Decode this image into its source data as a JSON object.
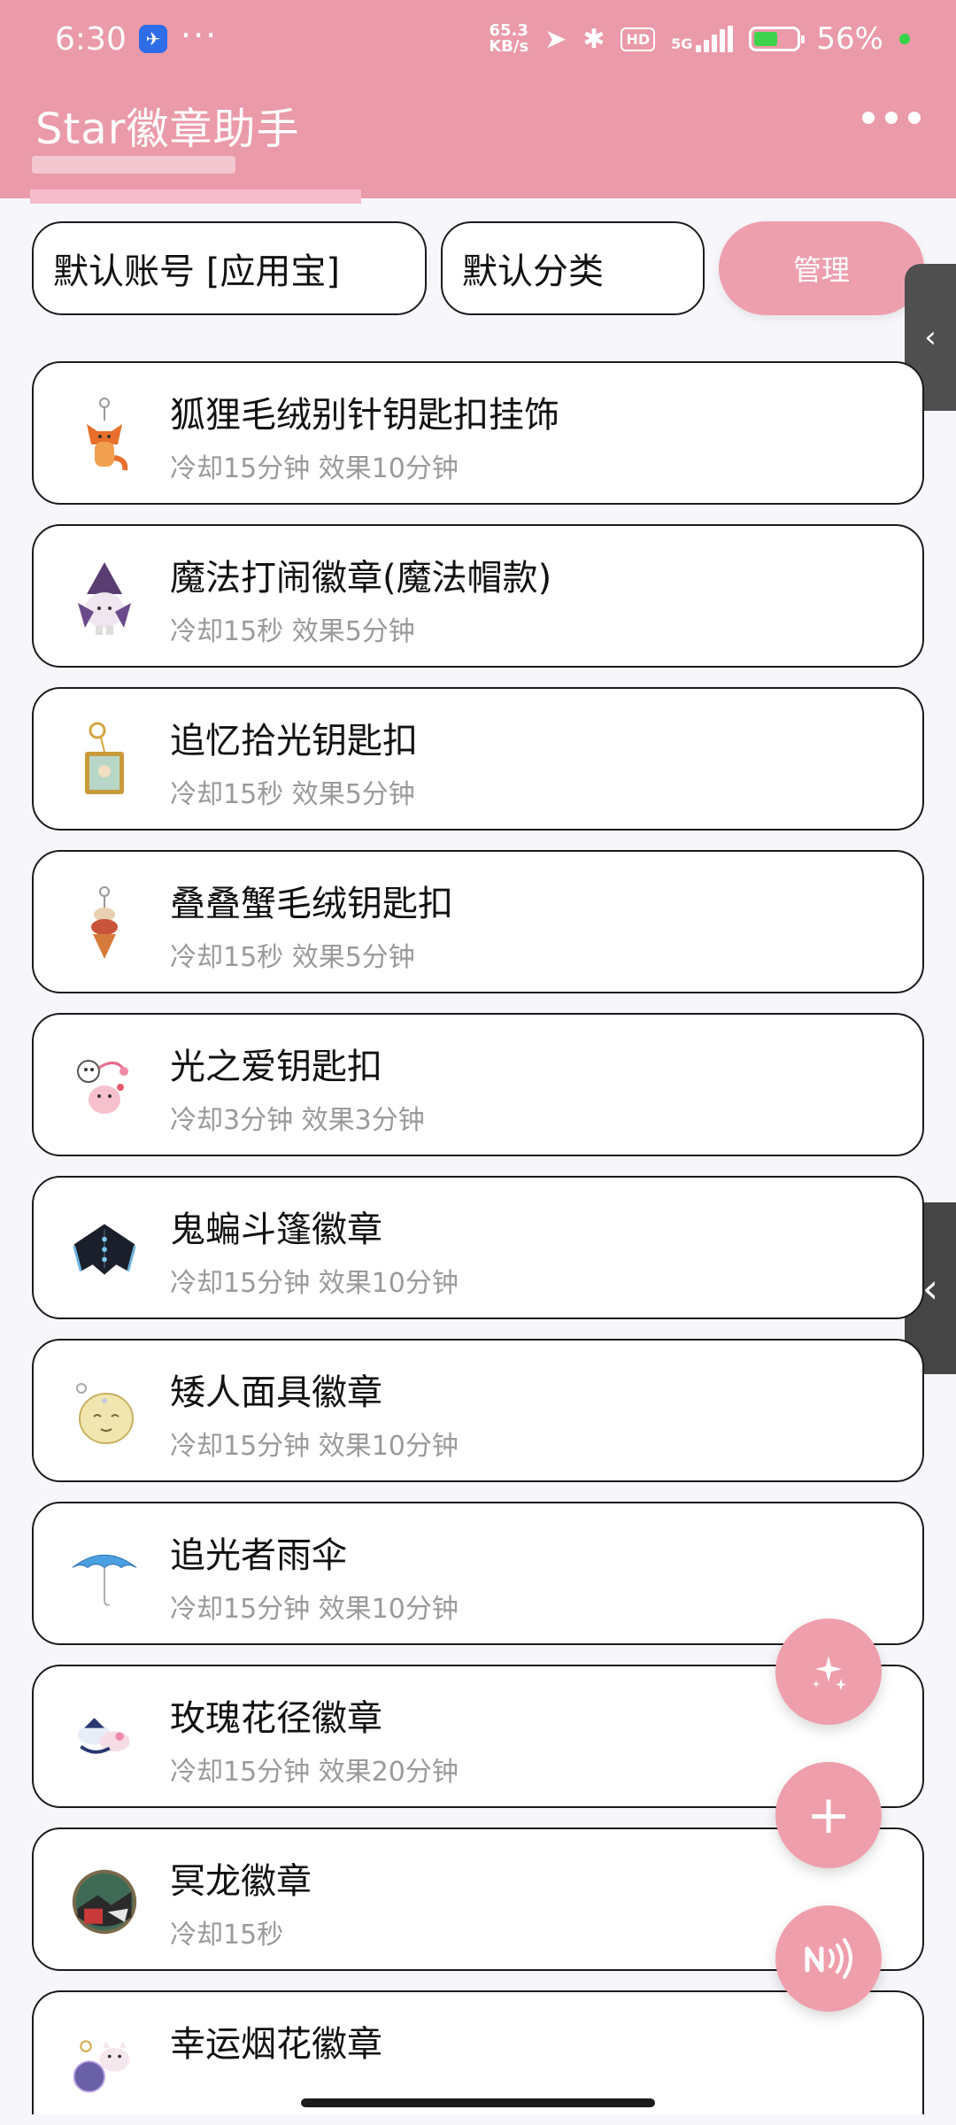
{
  "status_bar": {
    "time": "6:30",
    "more": "···",
    "net_speed_value": "65.3",
    "net_speed_unit": "KB/s",
    "hd_label": "HD",
    "network_label": "5G",
    "battery": "56%",
    "battery_level": 0.56
  },
  "header": {
    "title": "Star徽章助手",
    "more_icon": "more-horizontal-icon"
  },
  "filters": {
    "account": "默认账号 [应用宝]",
    "category": "默认分类",
    "manage_label": "管理"
  },
  "badges": [
    {
      "name": "狐狸毛绒别针钥匙扣挂饰",
      "desc": "冷却15分钟 效果10分钟",
      "icon": "fox-plush-keychain-icon"
    },
    {
      "name": "魔法打闹徽章(魔法帽款)",
      "desc": "冷却15秒 效果5分钟",
      "icon": "magic-hat-badge-icon"
    },
    {
      "name": "追忆拾光钥匙扣",
      "desc": "冷却15秒 效果5分钟",
      "icon": "memory-frame-keychain-icon"
    },
    {
      "name": "叠叠蟹毛绒钥匙扣",
      "desc": "冷却15秒 效果5分钟",
      "icon": "stacked-crab-plush-icon"
    },
    {
      "name": "光之爱钥匙扣",
      "desc": "冷却3分钟 效果3分钟",
      "icon": "light-of-love-keychain-icon"
    },
    {
      "name": "鬼蝙斗篷徽章",
      "desc": "冷却15分钟 效果10分钟",
      "icon": "ghost-bat-cape-badge-icon"
    },
    {
      "name": "矮人面具徽章",
      "desc": "冷却15分钟 效果10分钟",
      "icon": "dwarf-mask-badge-icon"
    },
    {
      "name": "追光者雨伞",
      "desc": "冷却15分钟 效果10分钟",
      "icon": "umbrella-icon"
    },
    {
      "name": "玫瑰花径徽章",
      "desc": "冷却15分钟 效果20分钟",
      "icon": "rose-path-badge-icon"
    },
    {
      "name": "冥龙徽章",
      "desc": "冷却15秒",
      "icon": "dark-dragon-badge-icon"
    },
    {
      "name": "幸运烟花徽章",
      "desc": "",
      "icon": "lucky-firework-badge-icon"
    }
  ],
  "fabs": {
    "sparkle": "sparkle-icon",
    "add": "+",
    "nfc": "nfc-icon"
  },
  "colors": {
    "header": "#ea9aa8",
    "accent": "#ef9fab",
    "background": "#f7f7fb"
  }
}
